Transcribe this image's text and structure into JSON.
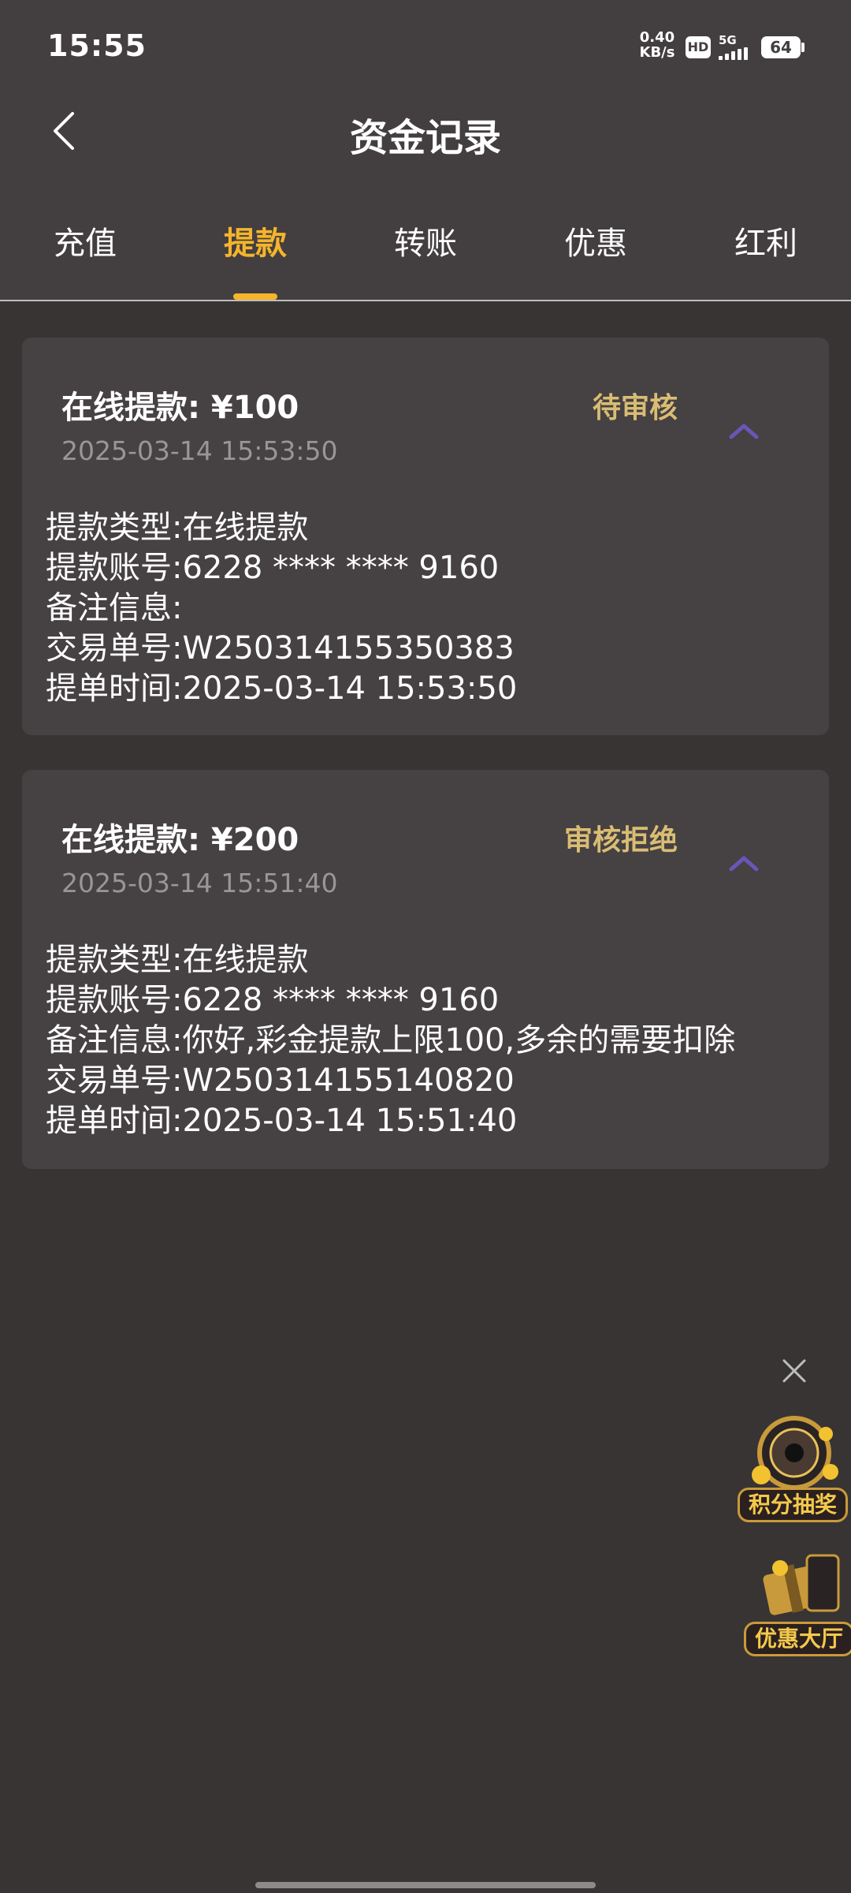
{
  "status_bar": {
    "time": "15:55",
    "net_speed_value": "0.40",
    "net_speed_unit": "KB/s",
    "hd": "HD",
    "network": "5G",
    "battery": "64"
  },
  "header": {
    "back_icon": "chevron-left-icon",
    "title": "资金记录"
  },
  "tabs": [
    {
      "label": "充值",
      "active": false
    },
    {
      "label": "提款",
      "active": true
    },
    {
      "label": "转账",
      "active": false
    },
    {
      "label": "优惠",
      "active": false
    },
    {
      "label": "红利",
      "active": false
    }
  ],
  "records": [
    {
      "title": "在线提款: ¥100",
      "datetime": "2025-03-14 15:53:50",
      "status": "待审核",
      "details": [
        {
          "label": "提款类型:",
          "value": "在线提款"
        },
        {
          "label": "提款账号:",
          "value": "6228 **** **** 9160"
        },
        {
          "label": "备注信息:",
          "value": ""
        },
        {
          "label": "交易单号:",
          "value": "W250314155350383"
        },
        {
          "label": "提单时间:",
          "value": "2025-03-14 15:53:50"
        }
      ]
    },
    {
      "title": "在线提款: ¥200",
      "datetime": "2025-03-14 15:51:40",
      "status": "审核拒绝",
      "details": [
        {
          "label": "提款类型:",
          "value": "在线提款"
        },
        {
          "label": "提款账号:",
          "value": "6228 **** **** 9160"
        },
        {
          "label": "备注信息:",
          "value": "你好,彩金提款上限100,多余的需要扣除"
        },
        {
          "label": "交易单号:",
          "value": "W250314155140820"
        },
        {
          "label": "提单时间:",
          "value": "2025-03-14 15:51:40"
        }
      ]
    }
  ],
  "floating": {
    "lottery_label": "积分抽奖",
    "promo_label": "优惠大厅"
  },
  "colors": {
    "background": "#383434",
    "header_bg": "#433e3f",
    "card_bg": "#464142",
    "accent": "#f4b52c",
    "status_text": "#d9bd74",
    "chevron": "#6a55b8"
  }
}
